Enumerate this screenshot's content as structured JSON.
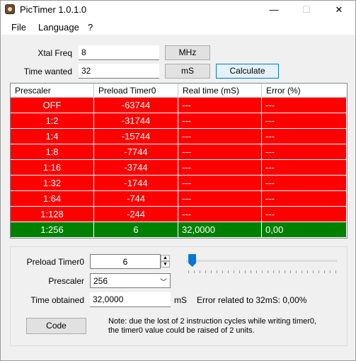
{
  "window": {
    "title": "PicTimer 1.0.1.0",
    "minimize_glyph": "—",
    "maximize_glyph": "☐",
    "close_glyph": "✕"
  },
  "menu": [
    "File",
    "Language",
    "?"
  ],
  "xtal": {
    "label": "Xtal Freq",
    "value": "8",
    "unit_button": "MHz"
  },
  "time": {
    "label": "Time wanted",
    "value": "32",
    "unit_button": "mS",
    "calculate_button": "Calculate"
  },
  "table": {
    "headers": [
      "Prescaler",
      "Preload Timer0",
      "Real time (mS)",
      "Error (%)"
    ],
    "rows": [
      {
        "prescaler": "OFF",
        "preload": "-63744",
        "real_time": "---",
        "error": "---",
        "status": "bad"
      },
      {
        "prescaler": "1:2",
        "preload": "-31744",
        "real_time": "---",
        "error": "---",
        "status": "bad"
      },
      {
        "prescaler": "1:4",
        "preload": "-15744",
        "real_time": "---",
        "error": "---",
        "status": "bad"
      },
      {
        "prescaler": "1:8",
        "preload": "-7744",
        "real_time": "---",
        "error": "---",
        "status": "bad"
      },
      {
        "prescaler": "1:16",
        "preload": "-3744",
        "real_time": "---",
        "error": "---",
        "status": "bad"
      },
      {
        "prescaler": "1:32",
        "preload": "-1744",
        "real_time": "---",
        "error": "---",
        "status": "bad"
      },
      {
        "prescaler": "1:64",
        "preload": "-744",
        "real_time": "---",
        "error": "---",
        "status": "bad"
      },
      {
        "prescaler": "1:128",
        "preload": "-244",
        "real_time": "---",
        "error": "---",
        "status": "bad"
      },
      {
        "prescaler": "1:256",
        "preload": "6",
        "real_time": "32,0000",
        "error": "0,00",
        "status": "good"
      }
    ],
    "colors": {
      "bad": "#ff0000",
      "good": "#008000"
    }
  },
  "lower": {
    "preload_label": "Preload Timer0",
    "preload_value": "6",
    "slider_fraction": 0.024,
    "prescaler_label": "Prescaler",
    "prescaler_value": "256",
    "time_obtained_label": "Time obtained",
    "time_obtained_value": "32,0000",
    "time_obtained_unit": "mS",
    "error_text": "Error related to 32mS: 0,00%",
    "code_button": "Code",
    "note": "Note: due the lost of 2 instruction cycles while writing timer0, the timer0 value could be raised of 2 units."
  }
}
